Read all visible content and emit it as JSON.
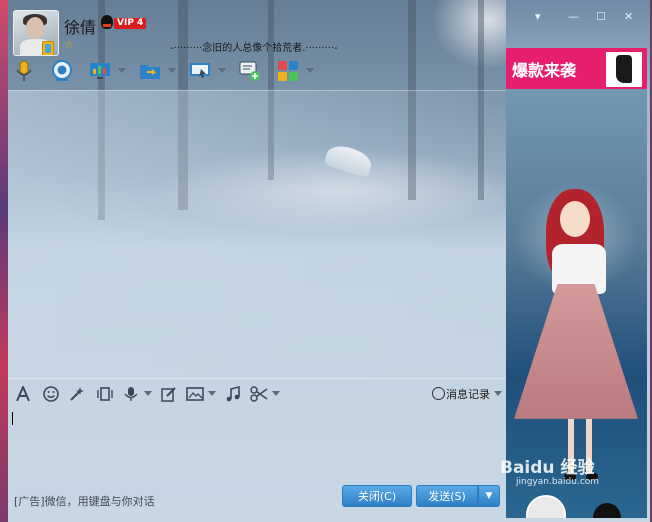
{
  "header": {
    "name": "徐倩",
    "vip_label": "VIP 4",
    "star": "☆",
    "signature": "-·········念旧的人总像个拾荒者.·········-"
  },
  "window_controls": {
    "pin": "▾",
    "minimize": "—",
    "maximize": "☐",
    "close": "✕"
  },
  "toolbar": {
    "items": [
      "voice-call",
      "video-call",
      "remote-desktop",
      "file-transfer",
      "screen-share",
      "create-group",
      "apps"
    ]
  },
  "ad": {
    "banner_text": "爆款来袭",
    "watermark": "Baidu 经验",
    "watermark_url": "jingyan.baidu.com"
  },
  "input_toolbar": {
    "history_label": "消息记录"
  },
  "footer": {
    "ad_text": "[广告]微信，用键盘与你对话",
    "close_label": "关闭(C)",
    "send_label": "发送(S)",
    "send_dropdown": "▼"
  },
  "colors": {
    "accent_blue": "#2e7fc6",
    "banner_pink": "#e61e6e",
    "vip_red": "#d81e1e"
  }
}
